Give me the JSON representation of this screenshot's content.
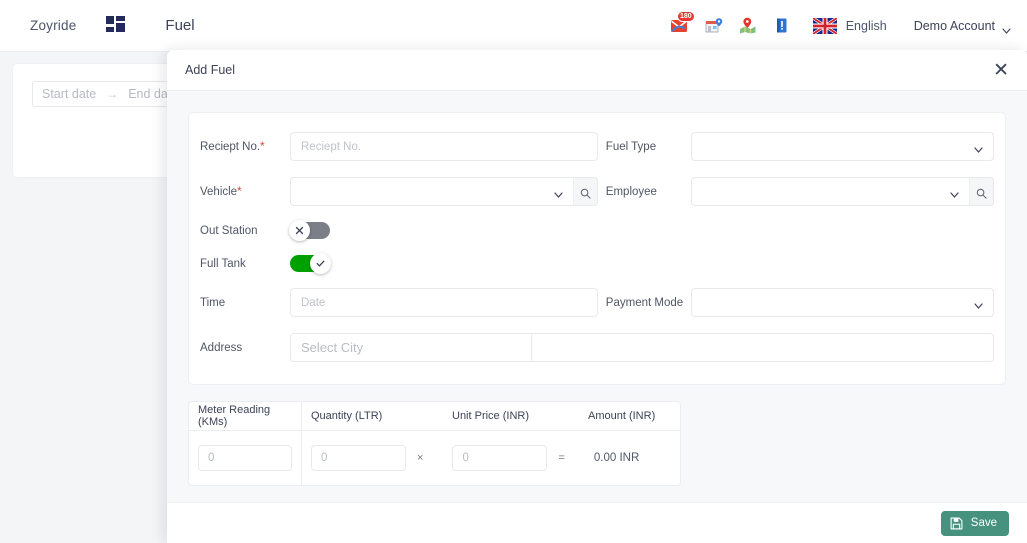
{
  "topbar": {
    "brand": "Zoyride",
    "grid_icon": "grid-apps-icon",
    "page_title": "Fuel",
    "icons": [
      {
        "name": "mail-icon",
        "badge": "180"
      },
      {
        "name": "store-location-icon",
        "badge": ""
      },
      {
        "name": "map-pin-icon",
        "badge": ""
      },
      {
        "name": "book-icon",
        "badge": ""
      }
    ],
    "flag_icon": "uk-flag-icon",
    "language": "English",
    "account": "Demo Account",
    "account_caret": "chevron-down-icon"
  },
  "background_page": {
    "start_date_placeholder": "Start date",
    "range_arrow": "→",
    "end_date_placeholder": "End date"
  },
  "modal": {
    "title": "Add Fuel",
    "close_icon": "close-icon",
    "save_label": "Save",
    "save_icon": "save-floppy-icon",
    "accent_color": "#47917f"
  },
  "form": {
    "receipt": {
      "label": "Reciept No.",
      "required": true,
      "placeholder": "Reciept No.",
      "value": ""
    },
    "fuel_type": {
      "label": "Fuel Type",
      "required": false,
      "value": "",
      "chevron_icon": "chevron-down-icon"
    },
    "vehicle": {
      "label": "Vehicle",
      "required": true,
      "value": "",
      "chevron_icon": "chevron-down-icon",
      "search_icon": "search-icon"
    },
    "employee": {
      "label": "Employee",
      "required": false,
      "value": "",
      "chevron_icon": "chevron-down-icon",
      "search_icon": "search-icon"
    },
    "out_station": {
      "label": "Out Station",
      "state": "off",
      "knob_icon": "close-x-icon",
      "off_color": "#7b7f87"
    },
    "full_tank": {
      "label": "Full Tank",
      "state": "on",
      "knob_icon": "check-icon",
      "on_color": "#00a000"
    },
    "time": {
      "label": "Time",
      "placeholder": "Date",
      "value": ""
    },
    "payment_mode": {
      "label": "Payment Mode",
      "value": "",
      "chevron_icon": "chevron-down-icon"
    },
    "address": {
      "label": "Address",
      "city_placeholder": "Select City",
      "city_value": "",
      "detail_value": ""
    }
  },
  "meter_table": {
    "headers": [
      "Meter Reading (KMs)",
      "Quantity (LTR)",
      "Unit Price (INR)",
      "Amount (INR)"
    ],
    "row": {
      "meter_reading": "0",
      "quantity": "0",
      "multiply_symbol": "×",
      "unit_price": "0",
      "equals_symbol": "=",
      "amount": "0.00 INR"
    }
  }
}
